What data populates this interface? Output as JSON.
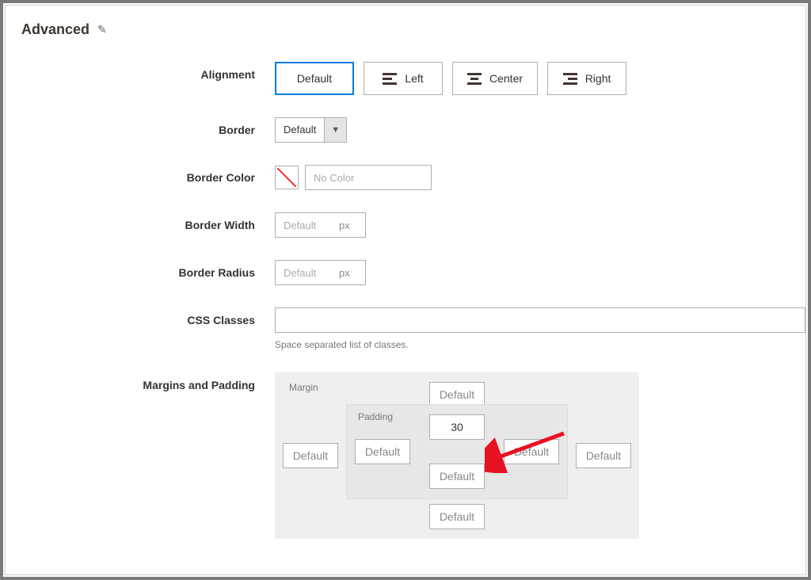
{
  "section": {
    "title": "Advanced"
  },
  "alignment": {
    "label": "Alignment",
    "options": [
      {
        "key": "default",
        "text": "Default",
        "selected": true
      },
      {
        "key": "left",
        "text": "Left",
        "selected": false
      },
      {
        "key": "center",
        "text": "Center",
        "selected": false
      },
      {
        "key": "right",
        "text": "Right",
        "selected": false
      }
    ]
  },
  "border": {
    "label": "Border",
    "value": "Default"
  },
  "borderColor": {
    "label": "Border Color",
    "placeholder": "No Color",
    "value": ""
  },
  "borderWidth": {
    "label": "Border Width",
    "placeholder": "Default",
    "unit": "px",
    "value": ""
  },
  "borderRadius": {
    "label": "Border Radius",
    "placeholder": "Default",
    "unit": "px",
    "value": ""
  },
  "cssClasses": {
    "label": "CSS Classes",
    "value": "",
    "hint": "Space separated list of classes."
  },
  "marginsPadding": {
    "label": "Margins and Padding",
    "marginLabel": "Margin",
    "paddingLabel": "Padding",
    "placeholder": "Default",
    "margin": {
      "top": "",
      "right": "",
      "bottom": "",
      "left": ""
    },
    "padding": {
      "top": "30",
      "right": "",
      "bottom": "",
      "left": ""
    }
  }
}
